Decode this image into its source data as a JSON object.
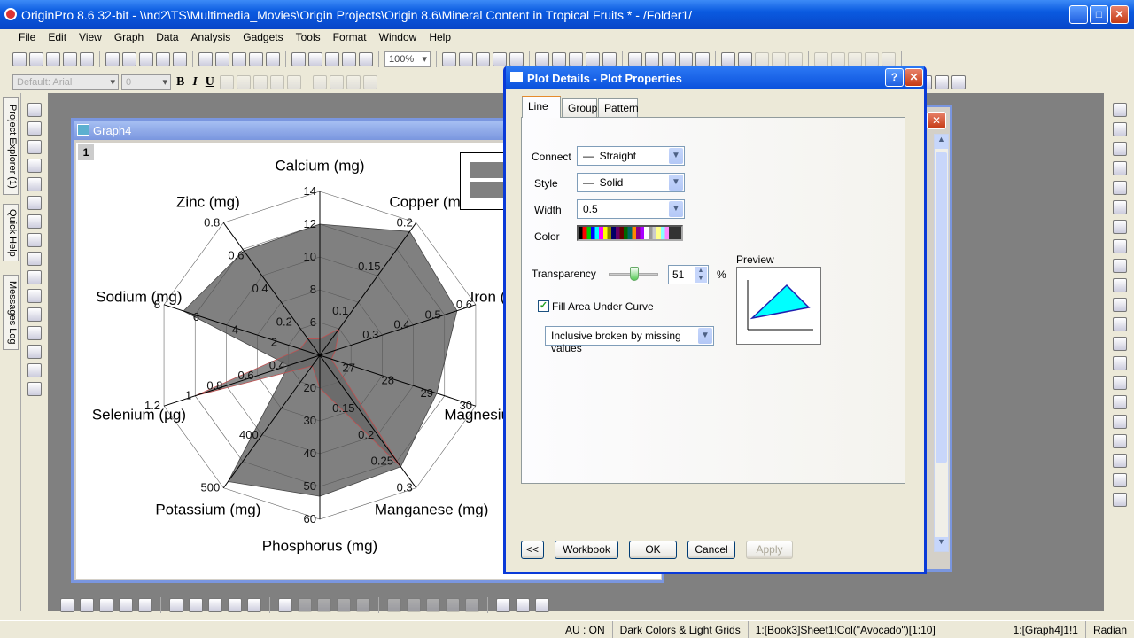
{
  "app": {
    "title": "OriginPro 8.6 32-bit - \\\\nd2\\TS\\Multimedia_Movies\\Origin Projects\\Origin 8.6\\Mineral Content in Tropical Fruits * - /Folder1/"
  },
  "menu": [
    "File",
    "Edit",
    "View",
    "Graph",
    "Data",
    "Analysis",
    "Gadgets",
    "Tools",
    "Format",
    "Window",
    "Help"
  ],
  "toolbar1": {
    "icons_left": [
      "new-project-icon",
      "new-folder-icon",
      "new-workbook-icon",
      "new-excel-icon",
      "new-graph-icon",
      "new-matrix-icon",
      "new-function-icon",
      "new-layout-icon",
      "new-notes-icon",
      "new-3d-icon",
      "open-icon",
      "open-template-icon",
      "open-excel-icon",
      "save-project-icon",
      "save-template-icon",
      "import-wizard-icon",
      "import-ascii-icon",
      "import-multiple-icon",
      "duplicate-icon",
      "recalculate-icon"
    ],
    "zoom": "100%",
    "icons_right": [
      "print-icon",
      "refresh-icon",
      "code-builder-icon",
      "results-log-icon",
      "command-window-icon",
      "project-explorer-icon",
      "layer-icon",
      "add-column-icon",
      "sum-icon",
      "sort-icon",
      "set-column-icon",
      "column-stats-icon",
      "line-plot-icon",
      "bar-plot-icon",
      "stacked-plot-icon",
      "set-x-icon",
      "set-y-icon",
      "set-z-icon",
      "error-bar-icon",
      "label-icon",
      "none-icon",
      "group-icon",
      "subgroup-icon",
      "first-icon",
      "previous-icon"
    ]
  },
  "toolbar2": {
    "font": "Default: Arial",
    "size": "0",
    "icons": [
      "bold-icon",
      "italic-icon",
      "underline-icon",
      "superscript-icon",
      "subscript-icon",
      "supsubscript-icon",
      "greek-icon",
      "increase-font-icon",
      "decrease-font-icon",
      "align-icon",
      "line-style-icon",
      "font-color-icon"
    ],
    "bold": "B",
    "italic": "I",
    "underline": "U",
    "icons_right": [
      "gadget-icon",
      "open-folder-icon",
      "copy-format-icon",
      "paste-format-icon",
      "clear-icon",
      "marker-m-icon",
      "remove-icon",
      "expand-icon",
      "collapse-icon"
    ]
  },
  "left_tabs": [
    "Project Explorer (1)",
    "Quick Help",
    "Messages Log"
  ],
  "left_tools": [
    "pointer-icon",
    "zoom-in-icon",
    "zoom-out-icon",
    "data-reader-icon",
    "screen-reader-icon",
    "data-selector-icon",
    "scale-in-icon",
    "mask-icon",
    "draw-data-icon",
    "text-tool-icon",
    "arrow-icon",
    "curved-arrow-icon",
    "rectangle-icon",
    "hand-icon",
    "region-icon",
    "annotate-icon"
  ],
  "right_tools": [
    "layer-arrange-icon",
    "arrange-icon",
    "add-layer-icon",
    "merge-icon",
    "extract-icon",
    "add-axis-icon",
    "rescale-icon",
    "swap-icon",
    "legend-icon",
    "table-icon",
    "timestamp-icon",
    "color-scale-icon",
    "layer-mgmt-icon",
    "align-left-icon",
    "align-right-icon",
    "align-top-icon",
    "align-bottom-icon",
    "same-width-icon",
    "same-height-icon",
    "front-icon",
    "back-icon"
  ],
  "bottom_tools": [
    "line-icon",
    "scatter-icon",
    "line-symbol-icon",
    "column-icon",
    "multi-column-icon",
    "stack-icon",
    "area-icon",
    "fill-area-icon",
    "polar-icon",
    "3d-icon",
    "statistics-icon",
    "template-icon",
    "contour-icon",
    "surface-icon",
    "image-icon",
    "vector-icon",
    "box-icon",
    "ternary-icon",
    "pie-icon",
    "grouped-icon",
    "stacked-lines-icon",
    "vertical-icon",
    "offset-icon"
  ],
  "graph_window": {
    "title": "Graph4",
    "layer": "1"
  },
  "chart_data": {
    "type": "radar",
    "axes": [
      {
        "label": "Calcium (mg)",
        "min": 4,
        "max": 14,
        "ticks": [
          6,
          8,
          10,
          12,
          14
        ]
      },
      {
        "label": "Copper (mg)",
        "min": 0.05,
        "max": 0.2,
        "ticks": [
          0.1,
          0.15,
          0.2
        ]
      },
      {
        "label": "Iron (mg)",
        "min": 0.1,
        "max": 0.6,
        "ticks": [
          0.3,
          0.4,
          0.5,
          0.6
        ]
      },
      {
        "label": "Magnesium (mg)",
        "min": 26,
        "max": 30,
        "ticks": [
          27,
          28,
          29,
          30
        ]
      },
      {
        "label": "Manganese (mg)",
        "min": 0.05,
        "max": 0.3,
        "ticks": [
          0.15,
          0.2,
          0.25,
          0.3
        ]
      },
      {
        "label": "Phosphorus (mg)",
        "min": 10,
        "max": 60,
        "ticks": [
          20,
          30,
          40,
          50,
          60
        ]
      },
      {
        "label": "Potassium (mg)",
        "min": 250,
        "max": 500,
        "ticks": [
          400,
          500
        ]
      },
      {
        "label": "Selenium (µg)",
        "min": 0.2,
        "max": 1.2,
        "ticks": [
          0.4,
          0.6,
          0.8,
          1,
          1.2
        ]
      },
      {
        "label": "Sodium (mg)",
        "min": 0,
        "max": 8,
        "ticks": [
          2,
          4,
          6,
          8
        ]
      },
      {
        "label": "Zinc (mg)",
        "min": 0,
        "max": 0.8,
        "ticks": [
          0.2,
          0.4,
          0.6,
          0.8
        ]
      }
    ],
    "series": [
      {
        "values": [
          12,
          0.19,
          0.54,
          29,
          0.26,
          53,
          488,
          0.4,
          7,
          0.63
        ],
        "fill": "#555555",
        "line": "#444444"
      },
      {
        "values": [
          5,
          0.08,
          0.15,
          26.3,
          0.26,
          20,
          270,
          1.0,
          1,
          0.1
        ],
        "fill": "#666666",
        "line": "#c05050"
      }
    ],
    "rings": 5,
    "legend": "top-right"
  },
  "dialog": {
    "title": "Plot Details - Plot Properties",
    "tabs": [
      "Line",
      "Group",
      "Pattern"
    ],
    "connect_label": "Connect",
    "connect_value": "Straight",
    "style_label": "Style",
    "style_value": "Solid",
    "width_label": "Width",
    "width_value": "0.5",
    "color_label": "Color",
    "transparency_label": "Transparency",
    "transparency_value": "51",
    "transparency_unit": "%",
    "transparency_percent": 51,
    "fill_label": "Fill Area Under Curve",
    "fill_checked": true,
    "fill_mode": "Inclusive broken by missing values",
    "preview_label": "Preview",
    "buttons": {
      "collapse": "<<",
      "workbook": "Workbook",
      "ok": "OK",
      "cancel": "Cancel",
      "apply": "Apply"
    }
  },
  "status": [
    "AU : ON",
    "Dark Colors & Light Grids",
    "1:[Book3]Sheet1!Col(\"Avocado\")[1:10]",
    "1:[Graph4]1!1",
    "Radian"
  ]
}
